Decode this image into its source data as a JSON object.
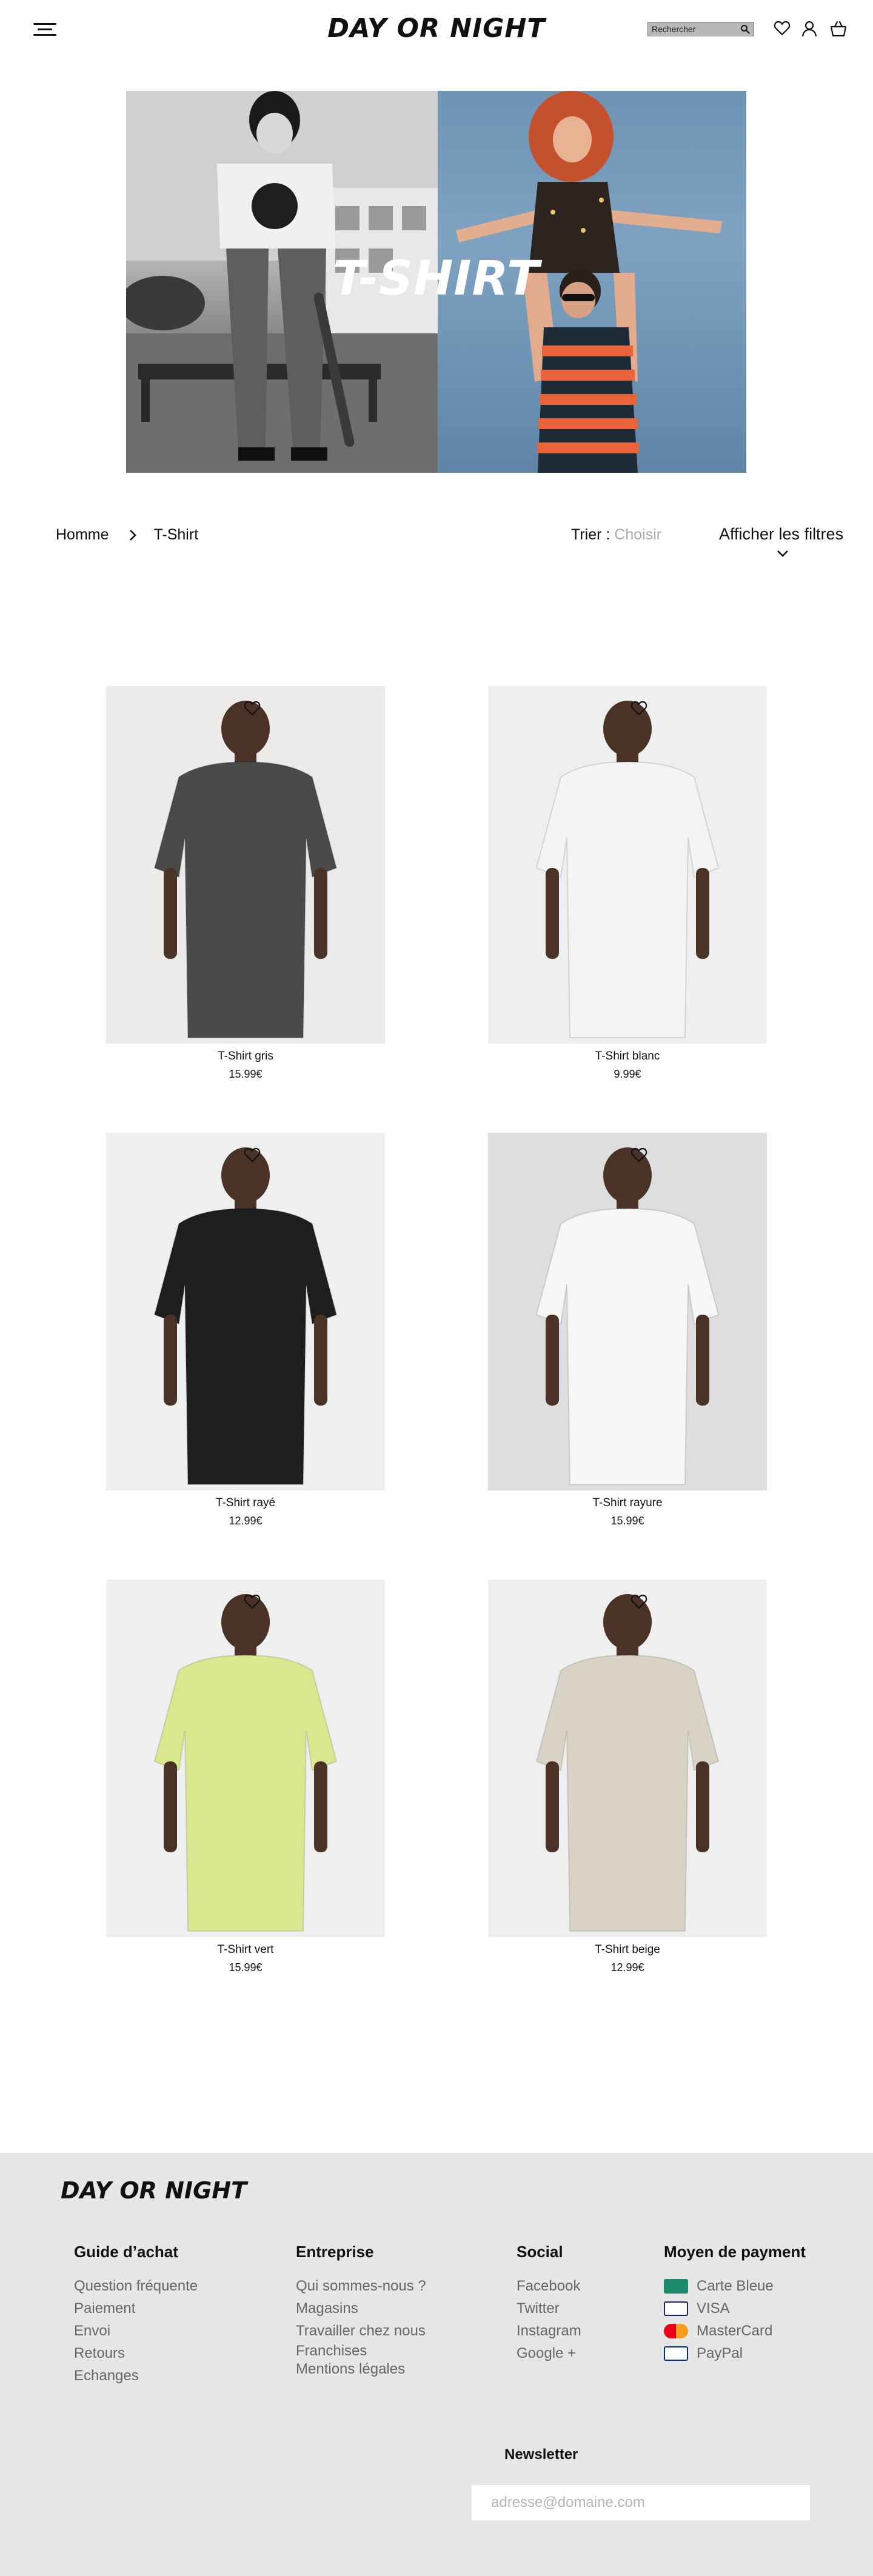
{
  "header": {
    "logo": "DAY OR NIGHT",
    "search_placeholder": "Rechercher"
  },
  "hero": {
    "title": "T-SHIRT"
  },
  "breadcrumb": {
    "home": "Homme",
    "current": "T-Shirt"
  },
  "sort": {
    "label": "Trier :",
    "value": "Choisir"
  },
  "filters": {
    "label": "Afficher les filtres"
  },
  "products": [
    {
      "name": "T-Shirt gris",
      "price": "15.99€",
      "shirt_color": "#4a4a48",
      "bg": "#ecebea"
    },
    {
      "name": "T-Shirt blanc",
      "price": "9.99€",
      "shirt_color": "#f4f4f4",
      "bg": "#efefef"
    },
    {
      "name": "T-Shirt rayé",
      "price": "12.99€",
      "shirt_color": "#1e1e1e",
      "bg": "#efefef"
    },
    {
      "name": "T-Shirt rayure",
      "price": "15.99€",
      "shirt_color": "#f6f6f6",
      "bg": "#dedede"
    },
    {
      "name": "T-Shirt vert",
      "price": "15.99€",
      "shirt_color": "#d9e88f",
      "bg": "#efefef"
    },
    {
      "name": "T-Shirt beige",
      "price": "12.99€",
      "shirt_color": "#d9d3c6",
      "bg": "#efefef"
    }
  ],
  "footer": {
    "logo": "DAY OR NIGHT",
    "guide": {
      "title": "Guide d’achat",
      "links": [
        "Question fréquente",
        "Paiement",
        "Envoi",
        "Retours",
        "Echanges"
      ]
    },
    "company": {
      "title": "Entreprise",
      "links": [
        "Qui sommes-nous ?",
        "Magasins",
        "Travailler chez nous",
        "Franchises",
        "Mentions légales"
      ]
    },
    "social": {
      "title": "Social",
      "links": [
        "Facebook",
        "Twitter",
        "Instagram",
        "Google +"
      ]
    },
    "payment": {
      "title": "Moyen de payment",
      "methods": [
        "Carte Bleue",
        "VISA",
        "MasterCard",
        "PayPal"
      ]
    },
    "newsletter": {
      "title": "Newsletter",
      "placeholder": "adresse@domaine.com"
    }
  }
}
